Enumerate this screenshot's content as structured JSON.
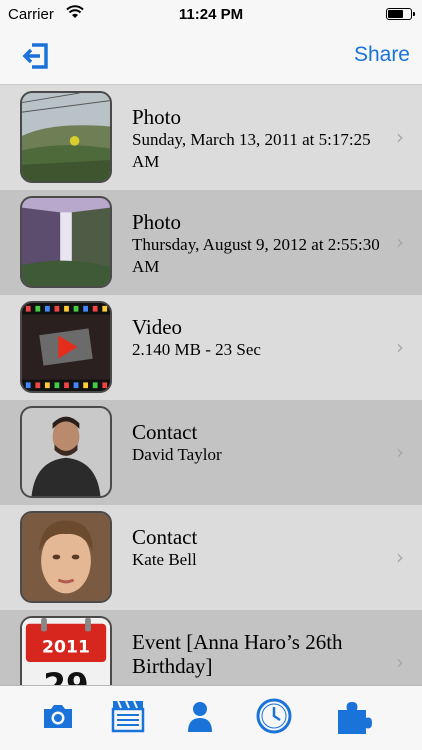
{
  "status_bar": {
    "carrier": "Carrier",
    "time": "11:24 PM"
  },
  "nav": {
    "share_label": "Share",
    "back_icon": "exit-icon"
  },
  "items": [
    {
      "type": "photo",
      "title": "Photo",
      "subtitle": "Sunday, March 13, 2011 at 5:17:25 AM"
    },
    {
      "type": "photo",
      "title": "Photo",
      "subtitle": "Thursday, August 9, 2012 at 2:55:30 AM"
    },
    {
      "type": "video",
      "title": "Video",
      "subtitle": "2.140 MB - 23 Sec"
    },
    {
      "type": "contact",
      "title": "Contact",
      "subtitle": "David Taylor"
    },
    {
      "type": "contact",
      "title": "Contact",
      "subtitle": "Kate Bell"
    },
    {
      "type": "event",
      "title": "Event [Anna Haro’s 26th Birthday]",
      "subtitle": "",
      "calendar_year": "2011",
      "calendar_day": "29"
    }
  ],
  "tabs": [
    {
      "name": "camera-icon"
    },
    {
      "name": "clapperboard-icon"
    },
    {
      "name": "person-icon"
    },
    {
      "name": "clock-icon"
    },
    {
      "name": "puzzle-icon"
    }
  ],
  "colors": {
    "accent": "#1a73d9",
    "row_light": "#dcdcdc",
    "row_dark": "#c3c3c3"
  }
}
